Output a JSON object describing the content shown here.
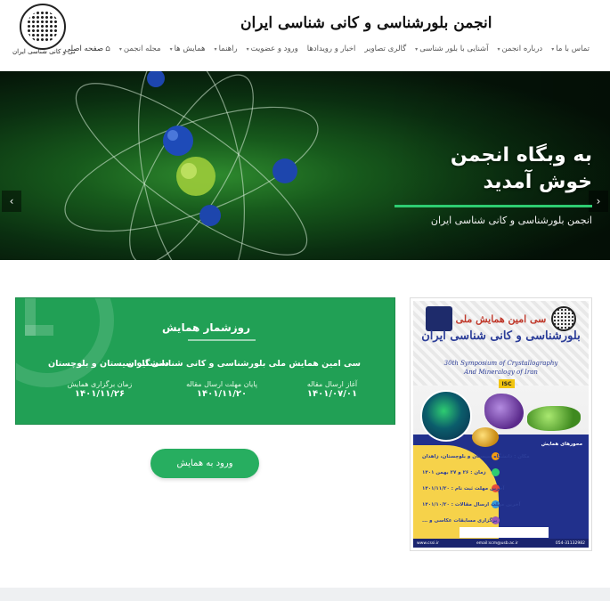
{
  "header": {
    "site_title": "انجمن بلورشناسی و کانی شناسی ایران",
    "logo_caption": "انجمن بلورشناسی و کانی شناسی ایران",
    "nav": [
      {
        "label": "صفحه اصلی",
        "dropdown": false,
        "icon": "home-icon"
      },
      {
        "label": "مجله انجمن",
        "dropdown": true
      },
      {
        "label": "همایش ها",
        "dropdown": true
      },
      {
        "label": "راهنما",
        "dropdown": true
      },
      {
        "label": "ورود و عضویت",
        "dropdown": true
      },
      {
        "label": "اخبار و رویدادها",
        "dropdown": false
      },
      {
        "label": "گالری تصاویر",
        "dropdown": false
      },
      {
        "label": "آشنایی با بلور شناسی",
        "dropdown": true
      },
      {
        "label": "درباره انجمن",
        "dropdown": true
      },
      {
        "label": "تماس با ما",
        "dropdown": true
      }
    ]
  },
  "slider": {
    "heading": "به وبگاه انجمن خوش آمدید",
    "subtitle": "انجمن بلورشناسی و کانی شناسی ایران",
    "prev_symbol": "‹",
    "next_symbol": "›"
  },
  "countdown": {
    "title": "روزشمار همایش",
    "event_name": "سی امین همایش ملی بلورشناسی و کانی شناسی ایران",
    "venue": "دانشگاه سیستان و بلوچستان",
    "items": [
      {
        "label": "آغاز ارسال مقاله",
        "date": "۱۴۰۱/۰۷/۰۱"
      },
      {
        "label": "پایان مهلت ارسال مقاله",
        "date": "۱۴۰۱/۱۱/۲۰"
      },
      {
        "label": "زمان برگزاری همایش",
        "date": "۱۴۰۱/۱۱/۲۶"
      }
    ]
  },
  "enter_button": "ورود به همایش",
  "poster": {
    "title_line1": "سی امین همایش ملی",
    "title_line2": "بلورشناسی و کانی شناسی ایران",
    "en_line1": "30th Symposium of Crystallography",
    "en_line2": "And Mineralogy of Iran",
    "badge": "ISC",
    "info_lines": [
      "مکان : دانشگاه سیستان و بلوچستان، زاهدان",
      "زمان : ۲۶ و ۲۷ بهمن ۱۴۰۱",
      "آخرین مهلت ثبت نام : ۱۴۰۱/۱۱/۲۰",
      "آخرین مهلت ارسال مقالات : ۱۴۰۱/۱۰/۲۰",
      "برگزاری مسابقات عکاسی و ..."
    ],
    "topics_title": "محورهای همایش",
    "footer_left": "www.cssi.ir",
    "footer_mid": "email:scm@usb.ac.ir",
    "footer_right": "054-31132982"
  },
  "colors": {
    "accent_green": "#27ae60",
    "card_green": "#21a055",
    "slider_underline": "#2ecc71"
  }
}
